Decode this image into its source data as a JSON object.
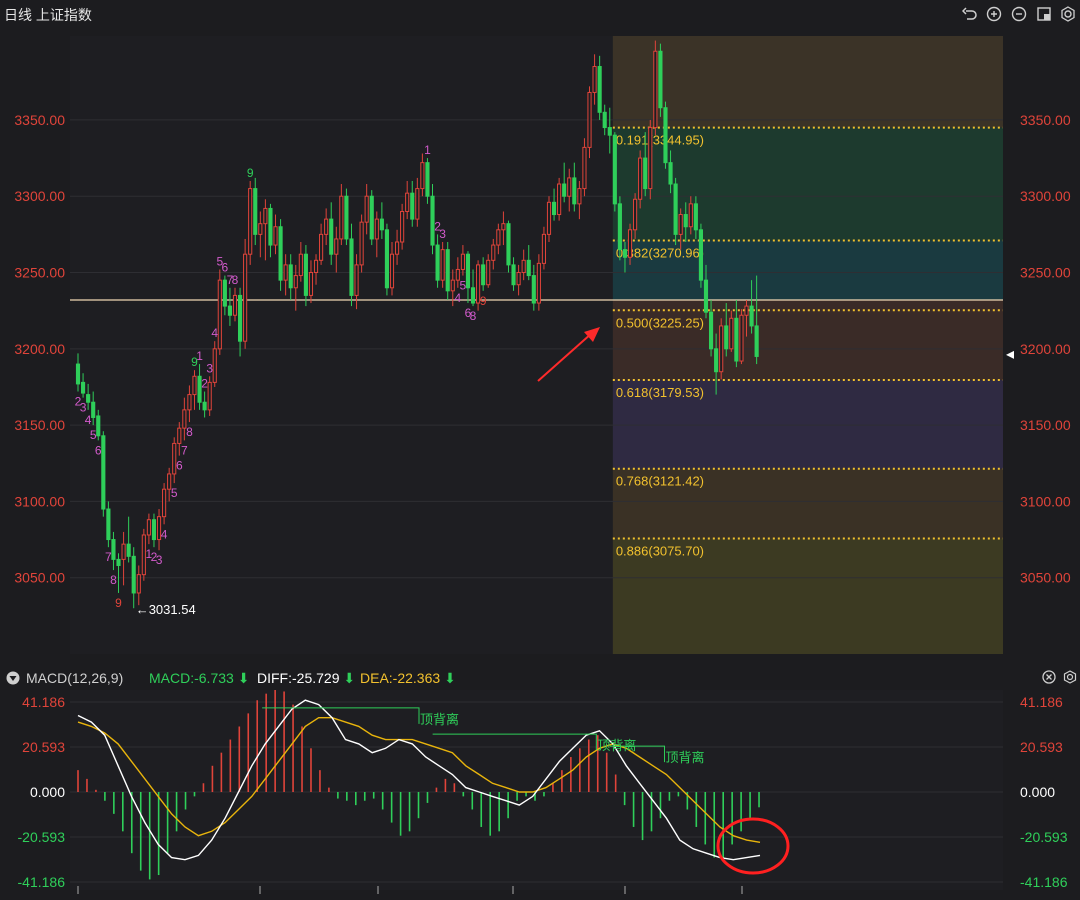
{
  "window": {
    "title": "日线 上证指数"
  },
  "toolbar": {
    "icons": [
      "undo-icon",
      "zoom-in-icon",
      "zoom-out-icon",
      "layout-icon",
      "settings-icon"
    ]
  },
  "colors": {
    "up": "#e0443a",
    "down": "#2fcf5a",
    "gold": "#f2c12e",
    "bg": "#1c1c1f",
    "diff": "#ffffff",
    "dea": "#e8b40c",
    "annotation_circle": "#ff2020",
    "hline": "#f0d8b4"
  },
  "chart_data": [
    {
      "type": "candlestick",
      "title": "日线 上证指数",
      "y_ticks": [
        "3350.00",
        "3300.00",
        "3250.00",
        "3200.00",
        "3150.00",
        "3100.00",
        "3050.00"
      ],
      "ylim": [
        3000,
        3405
      ],
      "low_label": "←3031.54",
      "horizontal_line": 3232,
      "price_marker": 3196,
      "candles": [
        [
          3190,
          3197,
          3172,
          3177
        ],
        [
          3178,
          3184,
          3168,
          3171
        ],
        [
          3170,
          3177,
          3160,
          3165
        ],
        [
          3165,
          3172,
          3150,
          3155
        ],
        [
          3156,
          3160,
          3140,
          3143
        ],
        [
          3143,
          3146,
          3090,
          3095
        ],
        [
          3095,
          3100,
          3070,
          3075
        ],
        [
          3075,
          3080,
          3055,
          3062
        ],
        [
          3062,
          3066,
          3040,
          3058
        ],
        [
          3062,
          3080,
          3045,
          3072
        ],
        [
          3072,
          3090,
          3060,
          3064
        ],
        [
          3064,
          3070,
          3030,
          3040
        ],
        [
          3040,
          3058,
          3032,
          3052
        ],
        [
          3052,
          3082,
          3048,
          3078
        ],
        [
          3078,
          3092,
          3072,
          3088
        ],
        [
          3088,
          3092,
          3070,
          3075
        ],
        [
          3075,
          3095,
          3068,
          3090
        ],
        [
          3090,
          3112,
          3085,
          3108
        ],
        [
          3108,
          3122,
          3100,
          3118
        ],
        [
          3118,
          3142,
          3112,
          3138
        ],
        [
          3138,
          3152,
          3130,
          3148
        ],
        [
          3148,
          3168,
          3140,
          3160
        ],
        [
          3160,
          3176,
          3152,
          3170
        ],
        [
          3170,
          3186,
          3160,
          3182
        ],
        [
          3182,
          3190,
          3160,
          3165
        ],
        [
          3165,
          3172,
          3155,
          3160
        ],
        [
          3160,
          3182,
          3156,
          3178
        ],
        [
          3178,
          3205,
          3175,
          3200
        ],
        [
          3200,
          3252,
          3196,
          3245
        ],
        [
          3245,
          3248,
          3222,
          3228
        ],
        [
          3228,
          3240,
          3215,
          3222
        ],
        [
          3222,
          3240,
          3218,
          3235
        ],
        [
          3235,
          3240,
          3195,
          3205
        ],
        [
          3205,
          3272,
          3200,
          3262
        ],
        [
          3262,
          3310,
          3255,
          3305
        ],
        [
          3305,
          3312,
          3268,
          3275
        ],
        [
          3275,
          3290,
          3260,
          3282
        ],
        [
          3282,
          3298,
          3258,
          3292
        ],
        [
          3292,
          3295,
          3260,
          3268
        ],
        [
          3268,
          3288,
          3262,
          3280
        ],
        [
          3280,
          3285,
          3238,
          3245
        ],
        [
          3245,
          3262,
          3235,
          3255
        ],
        [
          3255,
          3262,
          3232,
          3240
        ],
        [
          3240,
          3255,
          3225,
          3248
        ],
        [
          3248,
          3270,
          3244,
          3262
        ],
        [
          3262,
          3268,
          3228,
          3235
        ],
        [
          3235,
          3258,
          3230,
          3250
        ],
        [
          3250,
          3262,
          3242,
          3258
        ],
        [
          3258,
          3282,
          3255,
          3275
        ],
        [
          3275,
          3292,
          3268,
          3285
        ],
        [
          3285,
          3296,
          3255,
          3262
        ],
        [
          3262,
          3280,
          3250,
          3272
        ],
        [
          3272,
          3308,
          3268,
          3300
        ],
        [
          3300,
          3305,
          3268,
          3272
        ],
        [
          3272,
          3282,
          3228,
          3235
        ],
        [
          3235,
          3262,
          3226,
          3255
        ],
        [
          3255,
          3288,
          3250,
          3283
        ],
        [
          3283,
          3308,
          3275,
          3300
        ],
        [
          3300,
          3304,
          3268,
          3272
        ],
        [
          3272,
          3290,
          3260,
          3285
        ],
        [
          3285,
          3296,
          3272,
          3278
        ],
        [
          3278,
          3282,
          3235,
          3240
        ],
        [
          3240,
          3270,
          3235,
          3262
        ],
        [
          3262,
          3278,
          3255,
          3270
        ],
        [
          3270,
          3295,
          3265,
          3290
        ],
        [
          3290,
          3310,
          3285,
          3302
        ],
        [
          3302,
          3310,
          3280,
          3285
        ],
        [
          3285,
          3312,
          3280,
          3305
        ],
        [
          3305,
          3328,
          3300,
          3322
        ],
        [
          3322,
          3325,
          3295,
          3300
        ],
        [
          3300,
          3308,
          3262,
          3268
        ],
        [
          3268,
          3275,
          3240,
          3245
        ],
        [
          3245,
          3270,
          3240,
          3265
        ],
        [
          3265,
          3270,
          3232,
          3238
        ],
        [
          3238,
          3252,
          3228,
          3245
        ],
        [
          3245,
          3260,
          3240,
          3252
        ],
        [
          3252,
          3268,
          3248,
          3262
        ],
        [
          3262,
          3264,
          3230,
          3240
        ],
        [
          3240,
          3252,
          3228,
          3230
        ],
        [
          3230,
          3258,
          3225,
          3255
        ],
        [
          3255,
          3260,
          3238,
          3242
        ],
        [
          3242,
          3262,
          3240,
          3258
        ],
        [
          3258,
          3272,
          3252,
          3268
        ],
        [
          3268,
          3282,
          3262,
          3278
        ],
        [
          3278,
          3290,
          3268,
          3282
        ],
        [
          3282,
          3284,
          3250,
          3255
        ],
        [
          3255,
          3260,
          3238,
          3242
        ],
        [
          3242,
          3255,
          3235,
          3250
        ],
        [
          3250,
          3265,
          3245,
          3258
        ],
        [
          3258,
          3268,
          3245,
          3248
        ],
        [
          3248,
          3255,
          3225,
          3230
        ],
        [
          3230,
          3262,
          3225,
          3256
        ],
        [
          3256,
          3280,
          3252,
          3275
        ],
        [
          3275,
          3300,
          3270,
          3296
        ],
        [
          3296,
          3305,
          3284,
          3288
        ],
        [
          3288,
          3312,
          3284,
          3308
        ],
        [
          3308,
          3322,
          3296,
          3300
        ],
        [
          3300,
          3318,
          3290,
          3312
        ],
        [
          3312,
          3322,
          3290,
          3295
        ],
        [
          3295,
          3310,
          3285,
          3305
        ],
        [
          3305,
          3338,
          3300,
          3332
        ],
        [
          3332,
          3372,
          3325,
          3368
        ],
        [
          3368,
          3393,
          3360,
          3385
        ],
        [
          3385,
          3392,
          3350,
          3355
        ],
        [
          3355,
          3360,
          3340,
          3345
        ],
        [
          3345,
          3358,
          3328,
          3340
        ],
        [
          3340,
          3342,
          3290,
          3295
        ],
        [
          3295,
          3300,
          3258,
          3265
        ],
        [
          3265,
          3270,
          3250,
          3260
        ],
        [
          3260,
          3282,
          3255,
          3278
        ],
        [
          3278,
          3302,
          3272,
          3298
        ],
        [
          3298,
          3330,
          3292,
          3325
        ],
        [
          3325,
          3342,
          3300,
          3305
        ],
        [
          3305,
          3350,
          3298,
          3345
        ],
        [
          3345,
          3402,
          3340,
          3395
        ],
        [
          3395,
          3400,
          3352,
          3358
        ],
        [
          3358,
          3362,
          3318,
          3322
        ],
        [
          3322,
          3330,
          3302,
          3308
        ],
        [
          3308,
          3312,
          3268,
          3275
        ],
        [
          3275,
          3292,
          3265,
          3288
        ],
        [
          3288,
          3296,
          3270,
          3280
        ],
        [
          3280,
          3300,
          3275,
          3295
        ],
        [
          3295,
          3300,
          3272,
          3278
        ],
        [
          3278,
          3282,
          3240,
          3245
        ],
        [
          3245,
          3255,
          3220,
          3224
        ],
        [
          3224,
          3232,
          3195,
          3200
        ],
        [
          3200,
          3210,
          3170,
          3185
        ],
        [
          3185,
          3220,
          3180,
          3215
        ],
        [
          3215,
          3230,
          3195,
          3200
        ],
        [
          3200,
          3225,
          3198,
          3220
        ],
        [
          3220,
          3232,
          3188,
          3192
        ],
        [
          3192,
          3226,
          3190,
          3222
        ],
        [
          3222,
          3232,
          3208,
          3228
        ],
        [
          3228,
          3245,
          3210,
          3215
        ],
        [
          3215,
          3248,
          3190,
          3195
        ]
      ],
      "td_labels": [
        {
          "i": 0,
          "t": "2",
          "c": "#d35bcc",
          "d": 1
        },
        {
          "i": 1,
          "t": "3",
          "c": "#d35bcc",
          "d": 1
        },
        {
          "i": 2,
          "t": "4",
          "c": "#d35bcc",
          "d": 1
        },
        {
          "i": 3,
          "t": "5",
          "c": "#d35bcc",
          "d": 1
        },
        {
          "i": 4,
          "t": "6",
          "c": "#d35bcc",
          "d": 1
        },
        {
          "i": 6,
          "t": "7",
          "c": "#d35bcc",
          "d": 1
        },
        {
          "i": 7,
          "t": "8",
          "c": "#d35bcc",
          "d": 1
        },
        {
          "i": 8,
          "t": "9",
          "c": "#e0443a",
          "d": 1
        },
        {
          "i": 14,
          "t": "1",
          "c": "#d35bcc",
          "d": 1
        },
        {
          "i": 15,
          "t": "2",
          "c": "#d35bcc",
          "d": 1
        },
        {
          "i": 16,
          "t": "3",
          "c": "#d35bcc",
          "d": 1
        },
        {
          "i": 17,
          "t": "4",
          "c": "#d35bcc",
          "d": 1
        },
        {
          "i": 19,
          "t": "5",
          "c": "#d35bcc",
          "d": 1
        },
        {
          "i": 20,
          "t": "6",
          "c": "#d35bcc",
          "d": 1
        },
        {
          "i": 21,
          "t": "7",
          "c": "#d35bcc",
          "d": 1
        },
        {
          "i": 22,
          "t": "8",
          "c": "#d35bcc",
          "d": 1
        },
        {
          "i": 23,
          "t": "9",
          "c": "#2fcf5a",
          "d": -1
        },
        {
          "i": 24,
          "t": "1",
          "c": "#d35bcc",
          "d": -1
        },
        {
          "i": 25,
          "t": "2",
          "c": "#d35bcc",
          "d": -1
        },
        {
          "i": 26,
          "t": "3",
          "c": "#d35bcc",
          "d": -1
        },
        {
          "i": 27,
          "t": "4",
          "c": "#d35bcc",
          "d": -1
        },
        {
          "i": 28,
          "t": "5",
          "c": "#d35bcc",
          "d": -1
        },
        {
          "i": 29,
          "t": "6",
          "c": "#d35bcc",
          "d": -1
        },
        {
          "i": 30,
          "t": "7",
          "c": "#d35bcc",
          "d": -1
        },
        {
          "i": 31,
          "t": "8",
          "c": "#d35bcc",
          "d": -1
        },
        {
          "i": 34,
          "t": "9",
          "c": "#2fcf5a",
          "d": -1
        },
        {
          "i": 69,
          "t": "1",
          "c": "#d35bcc",
          "d": -1
        },
        {
          "i": 71,
          "t": "2",
          "c": "#d35bcc",
          "d": -1
        },
        {
          "i": 72,
          "t": "3",
          "c": "#d35bcc",
          "d": -1
        },
        {
          "i": 75,
          "t": "4",
          "c": "#d35bcc",
          "d": 1
        },
        {
          "i": 76,
          "t": "5",
          "c": "#d35bcc",
          "d": 1
        },
        {
          "i": 77,
          "t": "6",
          "c": "#d35bcc",
          "d": 1
        },
        {
          "i": 78,
          "t": "8",
          "c": "#d35bcc",
          "d": 1
        },
        {
          "i": 80,
          "t": "9",
          "c": "#e0443a",
          "d": 1
        }
      ],
      "fibonacci": {
        "base": 3232,
        "levels": [
          {
            "ratio": 0.191,
            "value": 3344.95,
            "label": "0.191(3344.95)"
          },
          {
            "ratio": 0.382,
            "value": 3270.96,
            "label": "0.382(3270.96)"
          },
          {
            "ratio": 0.5,
            "value": 3225.25,
            "label": "0.500(3225.25)"
          },
          {
            "ratio": 0.618,
            "value": 3179.53,
            "label": "0.618(3179.53)"
          },
          {
            "ratio": 0.768,
            "value": 3121.42,
            "label": "0.768(3121.42)"
          },
          {
            "ratio": 0.886,
            "value": 3075.7,
            "label": "0.886(3075.70)"
          }
        ],
        "zone_colors": [
          "#3b3327",
          "#1d3a2e",
          "#1a3a40",
          "#3a2b27",
          "#2f2a42",
          "#3a3125",
          "#3c3a22"
        ]
      },
      "grid": true
    },
    {
      "type": "macd",
      "title": "MACD(12,26,9)",
      "readouts": [
        {
          "label": "MACD:-6.733",
          "color": "#2fcf5a",
          "arrow": "⬇"
        },
        {
          "label": "DIFF:-25.729",
          "color": "#ffffff",
          "arrow": "⬇"
        },
        {
          "label": "DEA:-22.363",
          "color": "#f2c12e",
          "arrow": "⬇"
        }
      ],
      "y_ticks": [
        "41.186",
        "20.593",
        "0.000",
        "-20.593",
        "-41.186"
      ],
      "ylim": [
        -41.186,
        41.186
      ],
      "hist": [
        10,
        6,
        1,
        -4,
        -10,
        -18,
        -28,
        -36,
        -40,
        -38,
        -28,
        -18,
        -8,
        -2,
        4,
        12,
        18,
        24,
        30,
        36,
        42,
        45,
        48,
        46,
        40,
        30,
        20,
        10,
        2,
        -3,
        -4,
        -6,
        -4,
        -3,
        -8,
        -14,
        -20,
        -18,
        -12,
        -5,
        2,
        6,
        4,
        -2,
        -8,
        -16,
        -20,
        -18,
        -12,
        -4,
        -2,
        -4,
        -2,
        4,
        10,
        16,
        20,
        24,
        26,
        18,
        8,
        -6,
        -16,
        -22,
        -18,
        -12,
        -4,
        -2,
        -8,
        -16,
        -24,
        -30,
        -30,
        -24,
        -18,
        -12,
        -7
      ],
      "diff": [
        35,
        32,
        26,
        12,
        -2,
        -14,
        -24,
        -30,
        -31,
        -29,
        -22,
        -12,
        0,
        12,
        22,
        30,
        38,
        42,
        40,
        34,
        24,
        22,
        18,
        20,
        24,
        22,
        16,
        12,
        8,
        2,
        0,
        -2,
        -4,
        -6,
        -2,
        6,
        14,
        20,
        26,
        28,
        22,
        12,
        4,
        -4,
        -12,
        -22,
        -26,
        -28,
        -30,
        -31,
        -30,
        -29
      ],
      "dea": [
        32,
        30,
        27,
        22,
        14,
        6,
        -2,
        -10,
        -16,
        -20,
        -18,
        -14,
        -8,
        -2,
        6,
        14,
        22,
        30,
        34,
        34,
        32,
        30,
        26,
        24,
        24,
        24,
        22,
        20,
        18,
        12,
        8,
        4,
        2,
        0,
        0,
        2,
        6,
        10,
        16,
        20,
        22,
        20,
        16,
        12,
        8,
        2,
        -4,
        -10,
        -16,
        -20,
        -22,
        -23
      ],
      "divergences": [
        {
          "label": "顶背离",
          "from": 0.27,
          "to": 0.5,
          "y": 38.5
        },
        {
          "label": "顶背离",
          "from": 0.52,
          "to": 0.76,
          "y": 26.5
        },
        {
          "label": "顶背离",
          "from": 0.78,
          "to": 0.86,
          "y": 21
        }
      ],
      "circle": true
    }
  ]
}
